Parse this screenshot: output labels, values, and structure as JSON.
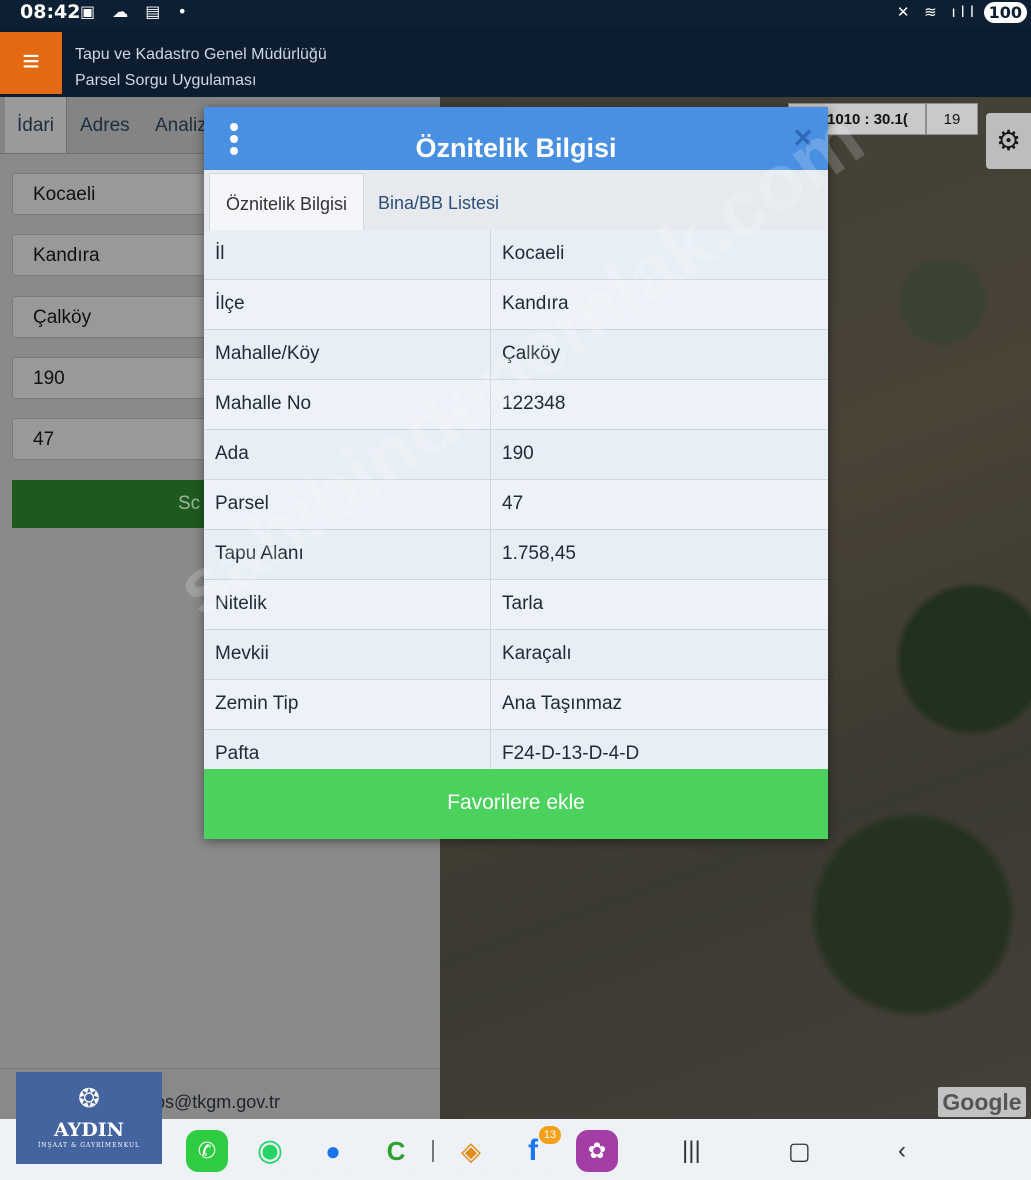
{
  "status_bar": {
    "time": "08:42",
    "battery": "100"
  },
  "app": {
    "title_line1": "Tapu ve Kadastro Genel Müdürlüğü",
    "title_line2": "Parsel Sorgu Uygulaması"
  },
  "left_panel": {
    "tabs": [
      "İdari",
      "Adres",
      "Analiz"
    ],
    "fields": {
      "il": "Kocaeli",
      "ilce": "Kandıra",
      "mahalle": "Çalköy",
      "ada": "190",
      "parsel": "47"
    },
    "query_button": "Sc",
    "email": "cbs@tkgm.gov.tr"
  },
  "map": {
    "scale": "1010 : 30.1(",
    "zoom": "19",
    "attribution": "Google"
  },
  "modal": {
    "title": "Öznitelik Bilgisi",
    "tabs": [
      "Öznitelik Bilgisi",
      "Bina/BB Listesi"
    ],
    "rows": [
      {
        "key": "İl",
        "value": "Kocaeli"
      },
      {
        "key": "İlçe",
        "value": "Kandıra"
      },
      {
        "key": "Mahalle/Köy",
        "value": "Çalköy"
      },
      {
        "key": "Mahalle No",
        "value": "122348"
      },
      {
        "key": "Ada",
        "value": "190"
      },
      {
        "key": "Parsel",
        "value": "47"
      },
      {
        "key": "Tapu Alanı",
        "value": "1.758,45"
      },
      {
        "key": "Nitelik",
        "value": "Tarla"
      },
      {
        "key": "Mevkii",
        "value": "Karaçalı"
      },
      {
        "key": "Zemin Tip",
        "value": "Ana Taşınmaz"
      },
      {
        "key": "Pafta",
        "value": "F24-D-13-D-4-D"
      }
    ],
    "favorite_button": "Favorilere ekle"
  },
  "watermark": "sahibindenemlak.com",
  "logo": {
    "name": "AYDIN",
    "subtitle": "İNŞAAT & GAYRİMENKUL"
  },
  "dock": {
    "facebook_badge": "13"
  },
  "colors": {
    "header": "#0c1d30",
    "modal_header": "#4a90e2",
    "favorite_button": "#4ad25c",
    "menu": "#e36a12"
  }
}
